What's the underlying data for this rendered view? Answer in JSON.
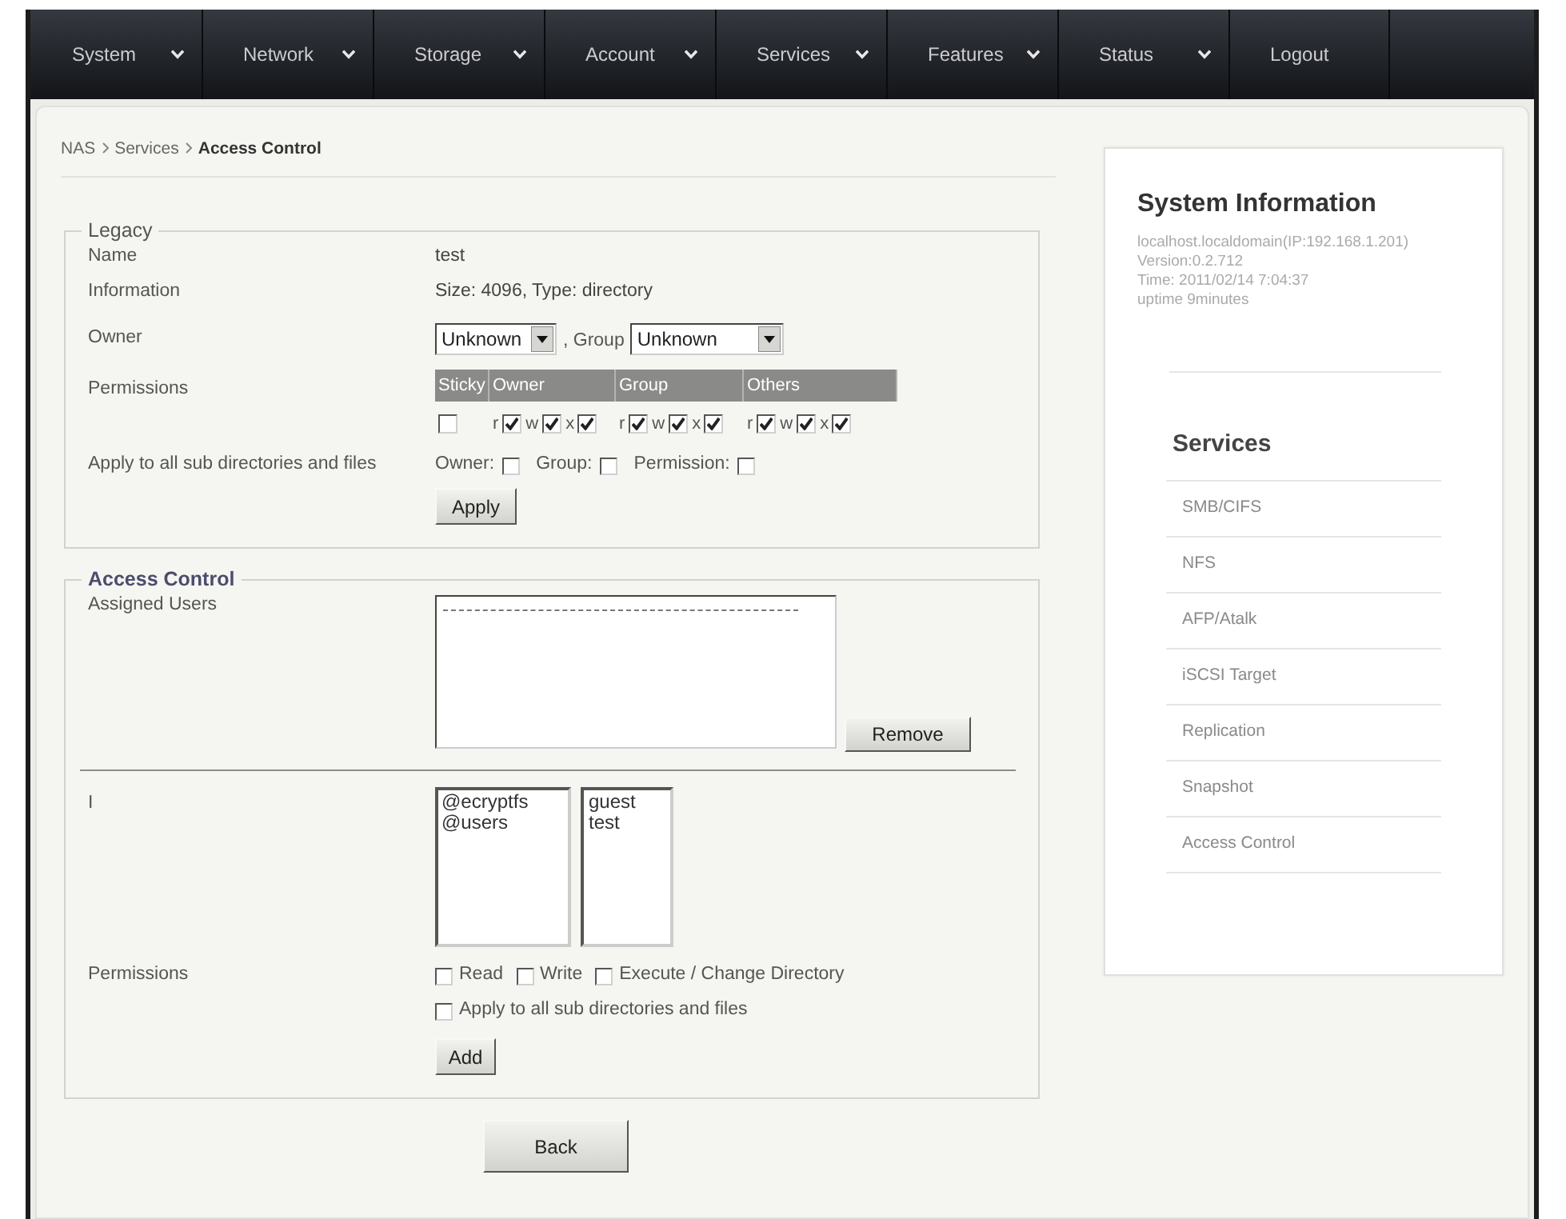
{
  "nav": [
    {
      "label": "System",
      "has_menu": true
    },
    {
      "label": "Network",
      "has_menu": true
    },
    {
      "label": "Storage",
      "has_menu": true
    },
    {
      "label": "Account",
      "has_menu": true
    },
    {
      "label": "Services",
      "has_menu": true
    },
    {
      "label": "Features",
      "has_menu": true
    },
    {
      "label": "Status",
      "has_menu": true
    },
    {
      "label": "Logout",
      "has_menu": false
    }
  ],
  "breadcrumb": [
    {
      "label": "NAS",
      "current": false
    },
    {
      "label": "Services",
      "current": false
    },
    {
      "label": "Access Control",
      "current": true
    }
  ],
  "legacy": {
    "legend": "Legacy",
    "name": {
      "label": "Name",
      "value": "test"
    },
    "information": {
      "label": "Information",
      "value": "Size: 4096, Type: directory"
    },
    "owner": {
      "label": "Owner",
      "owner_value": "Unknown",
      "group_label": ", Group",
      "group_value": "Unknown"
    },
    "permissions": {
      "label": "Permissions",
      "columns": [
        {
          "header": "Sticky",
          "bits": [
            {
              "checked": false
            }
          ]
        },
        {
          "header": "Owner",
          "bits": [
            {
              "label": "r",
              "checked": true
            },
            {
              "label": "w",
              "checked": true
            },
            {
              "label": "x",
              "checked": true
            }
          ]
        },
        {
          "header": "Group",
          "bits": [
            {
              "label": "r",
              "checked": true
            },
            {
              "label": "w",
              "checked": true
            },
            {
              "label": "x",
              "checked": true
            }
          ]
        },
        {
          "header": "Others",
          "bits": [
            {
              "label": "r",
              "checked": true
            },
            {
              "label": "w",
              "checked": true
            },
            {
              "label": "x",
              "checked": true
            }
          ]
        }
      ]
    },
    "apply_recursive": {
      "label": "Apply to all sub directories and files",
      "options": [
        {
          "label": "Owner:",
          "checked": false
        },
        {
          "label": "Group:",
          "checked": false
        },
        {
          "label": "Permission:",
          "checked": false
        }
      ]
    },
    "apply_button": "Apply"
  },
  "access_control": {
    "legend": "Access Control",
    "assigned_users": {
      "label": "Assigned Users",
      "remove_button": "Remove"
    },
    "picker": {
      "label": "I",
      "groups": [
        "@ecryptfs",
        "@users"
      ],
      "users": [
        "guest",
        "test"
      ]
    },
    "permissions": {
      "label": "Permissions",
      "options": [
        {
          "label": "Read",
          "checked": false
        },
        {
          "label": "Write",
          "checked": false
        },
        {
          "label": "Execute / Change Directory",
          "checked": false
        }
      ],
      "recursive": {
        "label": "Apply to all sub directories and files",
        "checked": false
      }
    },
    "add_button": "Add"
  },
  "back_button": "Back",
  "sidebar": {
    "system_info": {
      "title": "System Information",
      "lines": [
        "localhost.localdomain(IP:192.168.1.201)",
        "Version:0.2.712",
        "Time: 2011/02/14 7:04:37",
        "uptime 9minutes"
      ]
    },
    "services": {
      "title": "Services",
      "items": [
        "SMB/CIFS",
        "NFS",
        "AFP/Atalk",
        "iSCSI Target",
        "Replication",
        "Snapshot",
        "Access Control"
      ]
    }
  }
}
